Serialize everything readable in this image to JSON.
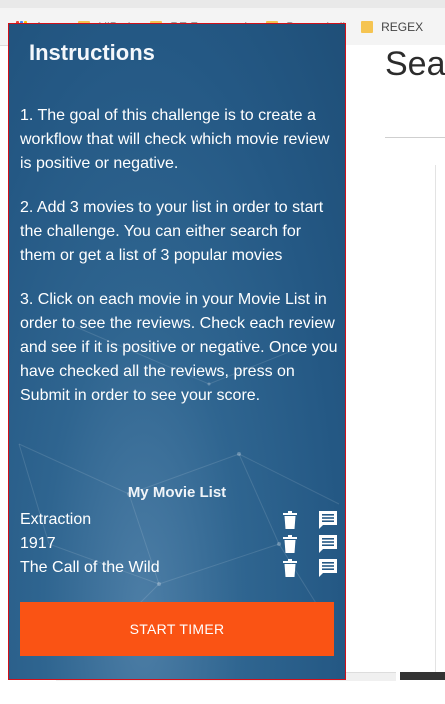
{
  "bookmarks": [
    {
      "label": "Apps",
      "icon": "apps-grid-icon"
    },
    {
      "label": "UiPath",
      "icon": "folder-icon"
    },
    {
      "label": "RE Framework",
      "icon": "folder-icon"
    },
    {
      "label": "Powershell",
      "icon": "folder-icon"
    },
    {
      "label": "REGEX",
      "icon": "folder-icon"
    }
  ],
  "page": {
    "title_partial": "Sea"
  },
  "sidebar": {
    "heading": "Instructions",
    "instructions": [
      "1. The goal of this challenge is to create a workflow that will check which movie review is positive or negative.",
      "2. Add 3 movies to your list in order to start the challenge. You can either search for them or get a list of 3 popular movies",
      "3. Click on each movie in your Movie List in order to see the reviews. Check each review and see if it is positive or negative. Once you have checked all the reviews, press on Submit in order to see your score."
    ],
    "movie_list_title": "My Movie List",
    "movies": [
      {
        "name": "Extraction"
      },
      {
        "name": "1917"
      },
      {
        "name": "The Call of the Wild"
      }
    ],
    "start_button": "START TIMER"
  },
  "colors": {
    "sidebar_bg": "#245884",
    "accent": "#fa5314",
    "highlight_border": "#d0101a"
  }
}
